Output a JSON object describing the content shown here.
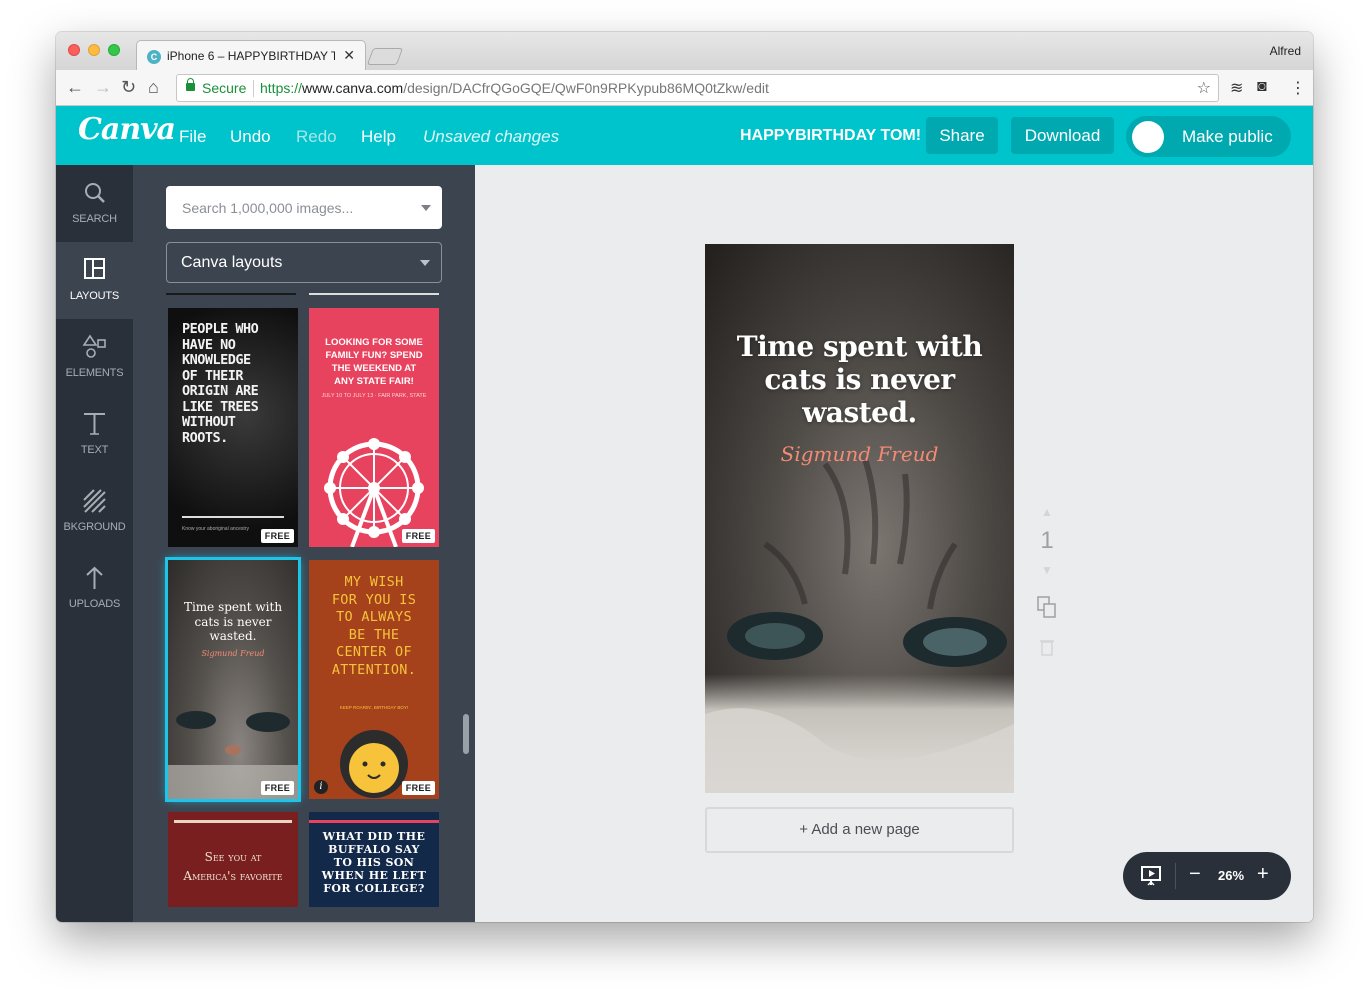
{
  "browser": {
    "tab_title": "iPhone 6 – HAPPYBIRTHDAY T",
    "user": "Alfred",
    "secure_label": "Secure",
    "url_scheme": "https://",
    "url_domain": "www.canva.com",
    "url_path": "/design/DACfrQGoGQE/QwF0n9RPKypub86MQ0tZkw/edit"
  },
  "header": {
    "logo": "Canva",
    "menu": [
      "File",
      "Undo",
      "Redo",
      "Help"
    ],
    "status": "Unsaved changes",
    "design_title": "HAPPYBIRTHDAY TOM!",
    "share_label": "Share",
    "download_label": "Download",
    "make_public_label": "Make public"
  },
  "sidebar": {
    "items": [
      {
        "label": "SEARCH",
        "icon": "search-icon"
      },
      {
        "label": "LAYOUTS",
        "icon": "layouts-icon"
      },
      {
        "label": "ELEMENTS",
        "icon": "elements-icon"
      },
      {
        "label": "TEXT",
        "icon": "text-icon"
      },
      {
        "label": "BKGROUND",
        "icon": "background-icon"
      },
      {
        "label": "UPLOADS",
        "icon": "uploads-icon"
      }
    ]
  },
  "panel": {
    "search_placeholder": "Search 1,000,000 images...",
    "layout_select": "Canva layouts",
    "badge": "FREE",
    "tiles": [
      {
        "text": "PEOPLE WHO HAVE NO KNOWLEDGE OF THEIR ORIGIN ARE LIKE TREES WITHOUT ROOTS.",
        "small": "Know your aboriginal ancestry",
        "bg": "#1c1c1c"
      },
      {
        "text": "LOOKING FOR SOME FAMILY FUN? SPEND THE WEEKEND AT ANY STATE FAIR!",
        "small": "JULY 10 TO JULY 13 · FAIR PARK, STATE",
        "bg": "#e8435e"
      },
      {
        "text": "Time spent with cats is never wasted.",
        "small": "Sigmund Freud",
        "bg": "#5c5a57"
      },
      {
        "text": "MY WISH FOR YOU IS TO ALWAYS BE THE CENTER OF ATTENTION.",
        "small": "KEEP ROARIN', BIRTHDAY BOY!",
        "bg": "#a5421b"
      },
      {
        "text": "See you at America's favorite",
        "bg": "#7a1f1f"
      },
      {
        "text": "WHAT DID THE BUFFALO SAY TO HIS SON WHEN HE LEFT FOR COLLEGE?",
        "bg": "#13294a"
      }
    ]
  },
  "canvas": {
    "quote": "Time spent with cats is never wasted.",
    "author": "Sigmund Freud",
    "page_number": "1",
    "add_page_label": "+ Add a new page",
    "zoom": "26%"
  },
  "colors": {
    "brand": "#00c4cc",
    "sidebar": "#293039",
    "panel": "#3c4450",
    "selected_outline": "#1dc6e8"
  }
}
